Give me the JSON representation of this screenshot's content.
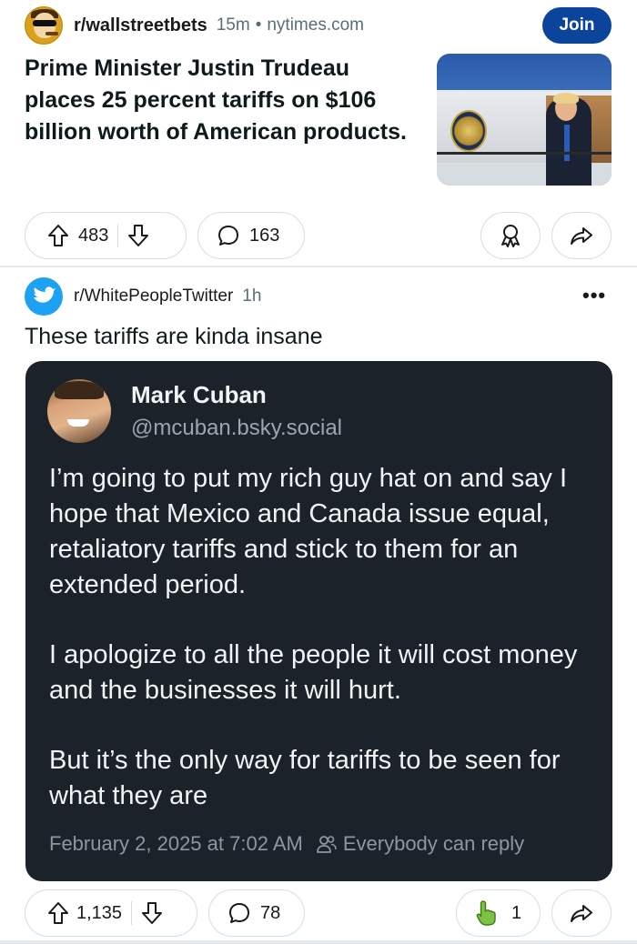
{
  "post1": {
    "subreddit": "r/wallstreetbets",
    "age": "15m",
    "separator": "•",
    "domain": "nytimes.com",
    "join_label": "Join",
    "title": "Prime Minister Justin Trudeau places 25 percent tariffs on $106 billion worth of American products.",
    "upvotes": "483",
    "comments": "163"
  },
  "post2": {
    "subreddit": "r/WhitePeopleTwitter",
    "age": "1h",
    "more_label": "•••",
    "title": "These tariffs are kinda insane",
    "tweet": {
      "author": "Mark Cuban",
      "handle": "@mcuban.bsky.social",
      "paragraphs": [
        "I’m going to put my rich guy hat on and say I hope that Mexico and Canada issue equal, retaliatory tariffs and stick to them for an extended period.",
        "I apologize to all the people it will cost money and the businesses it will hurt.",
        "But it’s the only way for tariffs to be seen for what they are"
      ],
      "timestamp": "February 2, 2025 at 7:02 AM",
      "reply_setting": "Everybody can reply"
    },
    "upvotes": "1,135",
    "comments": "78",
    "award_count": "1"
  },
  "colors": {
    "join_bg": "#0a449b",
    "card_bg": "#1c2229",
    "pill_border": "#d8dde0"
  },
  "icons": [
    "upvote-icon",
    "downvote-icon",
    "comment-icon",
    "award-icon",
    "share-icon",
    "people-icon",
    "pointing-hand-icon"
  ]
}
